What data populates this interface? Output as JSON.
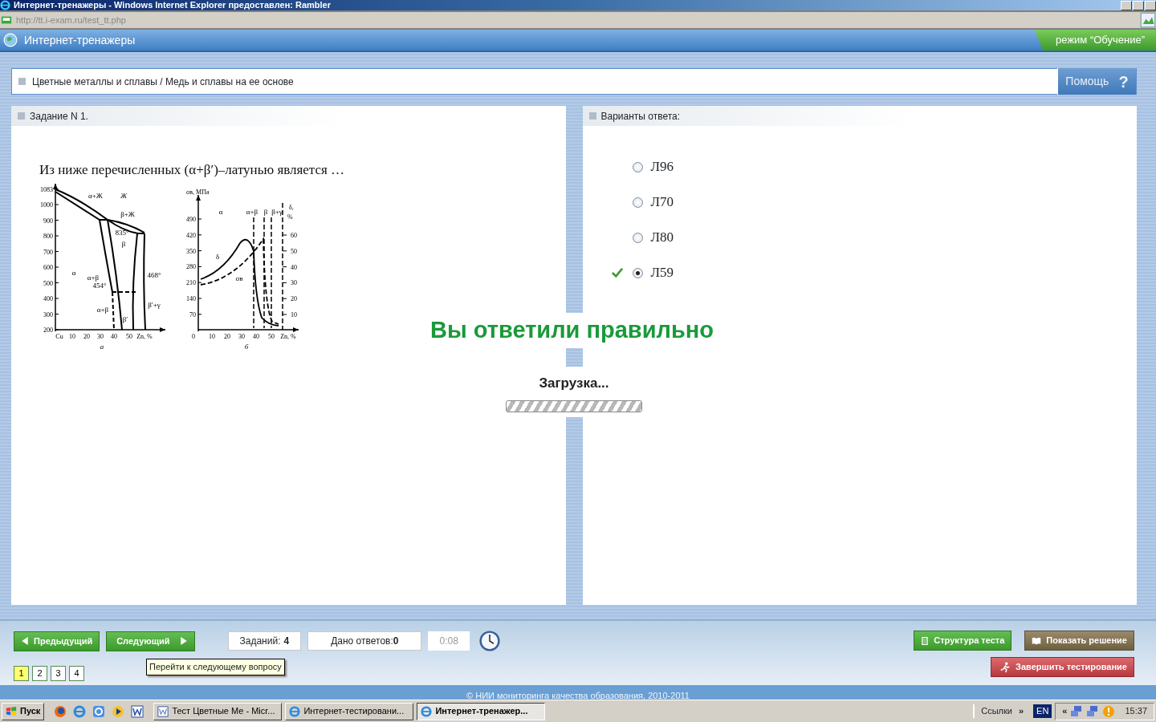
{
  "window": {
    "title": "Интернет-тренажеры - Windows Internet Explorer предоставлен: Rambler"
  },
  "address_bar": {
    "url": "http://tt.i-exam.ru/test_tt.php"
  },
  "header": {
    "title": "Интернет-тренажеры",
    "mode": "режим “Обучение”"
  },
  "breadcrumb": "Цветные металлы и сплавы / Медь и сплавы на ее основе",
  "help_button": {
    "label": "Помощь",
    "icon": "?"
  },
  "task": {
    "heading": "Задание N 1.",
    "question": "Из ниже перечисленных (α+β′)–латунью является …",
    "figure": {
      "a": {
        "y_ticks": [
          "1083",
          "1000",
          "900",
          "800",
          "700",
          "600",
          "500",
          "400",
          "300",
          "200"
        ],
        "x_ticks": [
          "Cu",
          "10",
          "20",
          "30",
          "40",
          "50",
          "Zn, %"
        ],
        "labels": [
          "α+Ж",
          "Ж",
          "β+Ж",
          "835°",
          "β",
          "α",
          "α+β",
          "454°",
          "468°",
          "α+β",
          "β′",
          "β′+γ"
        ],
        "caption": "а"
      },
      "b": {
        "y_title": "σв, МПа",
        "y_ticks": [
          "490",
          "420",
          "350",
          "280",
          "210",
          "140",
          "70"
        ],
        "x_ticks": [
          "0",
          "10",
          "20",
          "30",
          "40",
          "50",
          "Zn, %"
        ],
        "right_title": "δ,",
        "right_unit": "%",
        "right_ticks": [
          "60",
          "50",
          "40",
          "30",
          "20",
          "10"
        ],
        "labels": [
          "α",
          "α+β",
          "β",
          "β+γ",
          "δ",
          "σв"
        ],
        "caption": "б"
      }
    }
  },
  "answers": {
    "heading": "Варианты ответа:",
    "options": [
      {
        "label": "Л96",
        "selected": false,
        "correct": false
      },
      {
        "label": "Л70",
        "selected": false,
        "correct": false
      },
      {
        "label": "Л80",
        "selected": false,
        "correct": false
      },
      {
        "label": "Л59",
        "selected": true,
        "correct": true
      }
    ]
  },
  "result": "Вы ответили правильно",
  "loading": "Загрузка...",
  "toolbar": {
    "prev": "Предыдущий",
    "next": "Следующий",
    "tasks_label": "Заданий:",
    "tasks_count": "4",
    "answers_label": "Дано ответов:",
    "answers_count": "0",
    "timer": "0:08",
    "structure": "Структура теста",
    "solution": "Показать решение",
    "finish": "Завершить тестирование",
    "pages": [
      {
        "label": "1",
        "selected": true
      },
      {
        "label": "2",
        "selected": false
      },
      {
        "label": "3",
        "selected": false
      },
      {
        "label": "4",
        "selected": false
      }
    ],
    "tooltip": "Перейти к следующему вопросу"
  },
  "footer": "© НИИ мониторинга качества образования, 2010-2011",
  "taskbar": {
    "start": "Пуск",
    "tasks": [
      {
        "label": "Тест Цветные Ме - Micr...",
        "selected": false
      },
      {
        "label": "Интернет-тестировани...",
        "selected": false
      },
      {
        "label": "Интернет-тренажер...",
        "selected": true
      }
    ],
    "links": "Ссылки",
    "links_more": "»",
    "language": "EN",
    "tray_toggle": "«",
    "clock": "15:37"
  }
}
